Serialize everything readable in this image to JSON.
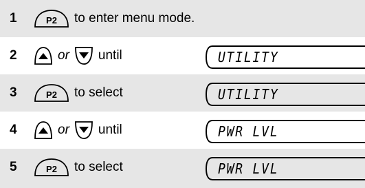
{
  "steps": [
    {
      "number": "1",
      "buttons": [
        "P2"
      ],
      "text": "to enter menu mode.",
      "display": ""
    },
    {
      "number": "2",
      "buttons": [
        "up",
        "down"
      ],
      "connector": "or",
      "text": "until",
      "display": "UTILITY"
    },
    {
      "number": "3",
      "buttons": [
        "P2"
      ],
      "text": "to select",
      "display": "UTILITY"
    },
    {
      "number": "4",
      "buttons": [
        "up",
        "down"
      ],
      "connector": "or",
      "text": "until",
      "display": "PWR LVL"
    },
    {
      "number": "5",
      "buttons": [
        "P2"
      ],
      "text": "to select",
      "display": "PWR LVL"
    }
  ],
  "keys": {
    "p2_label": "P2"
  },
  "icons": {
    "p2": "p2-key-icon",
    "up": "up-arrow-key-icon",
    "down": "down-arrow-key-icon"
  },
  "colors": {
    "shade": "#e6e6e6",
    "ink": "#000000"
  }
}
